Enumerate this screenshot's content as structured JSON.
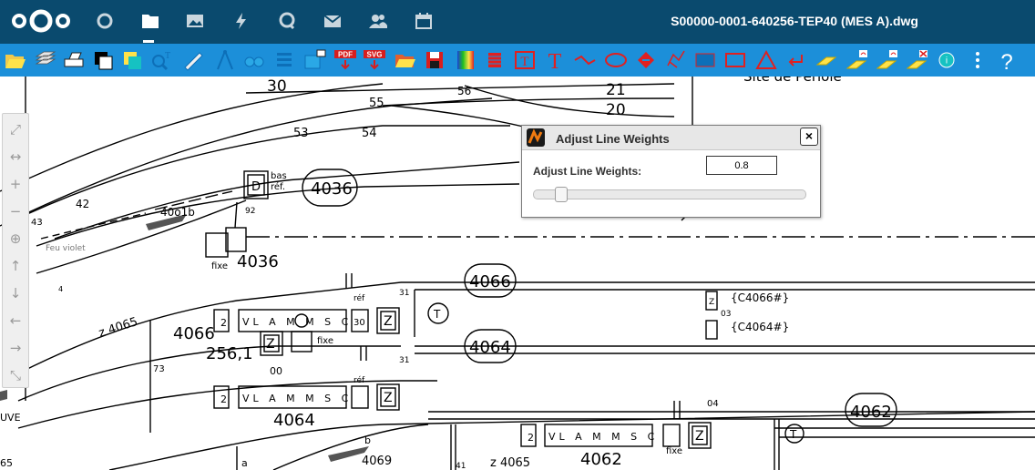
{
  "header": {
    "title": "S00000-0001-640256-TEP40 (MES A).dwg",
    "apps": [
      "circle-icon",
      "folder-icon",
      "image-icon",
      "lightning-icon",
      "search-icon",
      "mail-icon",
      "contacts-icon",
      "calendar-icon"
    ],
    "active_app": "folder-icon"
  },
  "colors": {
    "header_bg": "#0a4a6e",
    "toolbar_bg": "#1c8fd9",
    "icon_yellow": "#ffe24a",
    "icon_red": "#e02020",
    "icon_blue": "#0d6fb8"
  },
  "toolbar": {
    "pdf_label": "PDF",
    "svg_label": "SVG"
  },
  "navigation": {
    "items": [
      "zoom-extents-icon",
      "pan-horizontal-icon",
      "zoom-in-icon",
      "zoom-out-icon",
      "zoom-window-icon",
      "pan-up-icon",
      "pan-down-icon",
      "pan-left-icon",
      "pan-right-icon",
      "zoom-previous-icon"
    ]
  },
  "dialog": {
    "title": "Adjust Line Weights",
    "label": "Adjust Line Weights:",
    "value": "0.8",
    "slider_fraction": 0.08
  },
  "drawing": {
    "labels": {
      "n30": "30",
      "n55": "55",
      "n56": "56",
      "n21": "21",
      "n20": "20",
      "n53": "53",
      "n54": "54",
      "site": "Site de Périole",
      "bas": "bas",
      "ref_top": "réf.",
      "d": "D",
      "bubble4036": "4036",
      "n42": "42",
      "n43": "43",
      "n4001b": "40o1b",
      "n92": "92",
      "feu": "Feu violet",
      "fixe1": "fixe",
      "big4036": "4036",
      "z4065": "z 4065",
      "bubble4066": "4066",
      "bubble4064": "4064",
      "bubble4062": "4062",
      "ref1": "réf",
      "ref2": "réf",
      "n31a": "31",
      "n31b": "31",
      "big4066": "4066",
      "sub2561": "256,1",
      "n00": "00",
      "n73": "73",
      "fixe2": "fixe",
      "fixe3": "fixe",
      "c4066": "{C4066#}",
      "c4064": "{C4064#}",
      "n03": "03",
      "t1": "T",
      "t2": "T",
      "big4064": "4064",
      "big4062": "4062",
      "n04": "04",
      "b": "b",
      "a": "a",
      "n4069": "4069",
      "z4065b": "z 4065",
      "n41": "41",
      "n65": "65",
      "nuve": "UVE",
      "n2": "2",
      "n30b": "30",
      "z1": "Z",
      "z2": "Z",
      "z3": "Z",
      "z4": "Z",
      "z5": "Z",
      "box_4066": "VL A M M S C",
      "box_4064": "VL A M M S C",
      "box_4062": "VL A M M S C",
      "n4": "4",
      "top_2a": "2",
      "top_2b": "2"
    }
  }
}
